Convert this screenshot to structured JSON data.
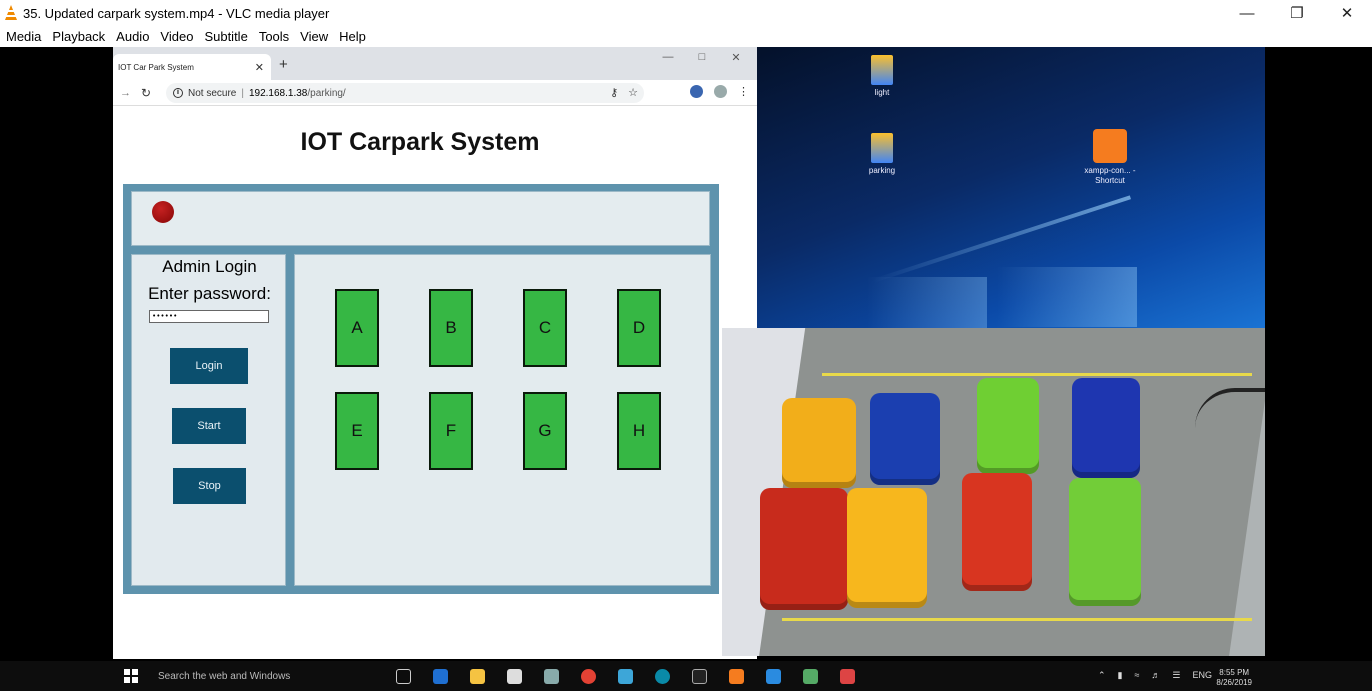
{
  "vlc": {
    "title": "35. Updated carpark system.mp4 - VLC media player",
    "menu": [
      "Media",
      "Playback",
      "Audio",
      "Video",
      "Subtitle",
      "Tools",
      "View",
      "Help"
    ]
  },
  "browser": {
    "tab_title": "IOT Car Park System",
    "not_secure": "Not secure",
    "url_host": "192.168.1.38",
    "url_path": "/parking/"
  },
  "page": {
    "title": "IOT Carpark System",
    "admin_title": "Admin Login",
    "password_label": "Enter password:",
    "password_value": "••••••",
    "login_button": "Login",
    "start_button": "Start",
    "stop_button": "Stop",
    "status_led_color": "#a40f0f",
    "slot_color": "#36b744",
    "slots": [
      "A",
      "B",
      "C",
      "D",
      "E",
      "F",
      "G",
      "H"
    ]
  },
  "desktop": {
    "icons": [
      "light",
      "parking",
      "xampp-con... - Shortcut"
    ]
  },
  "taskbar": {
    "search_placeholder": "Search the web and Windows",
    "language": "ENG",
    "time": "8:55 PM",
    "date": "8/26/2019"
  }
}
